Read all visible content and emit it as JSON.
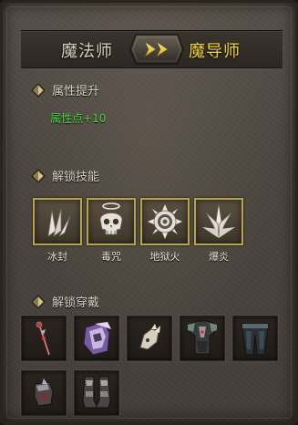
{
  "header": {
    "from_class": "魔法师",
    "to_class": "魔导师"
  },
  "attributes": {
    "title": "属性提升",
    "value": "属性点+10"
  },
  "skills": {
    "title": "解锁技能",
    "items": [
      {
        "name": "冰封",
        "icon": "ice-shard-icon"
      },
      {
        "name": "毒咒",
        "icon": "poison-skull-icon"
      },
      {
        "name": "地狱火",
        "icon": "hellfire-ring-icon"
      },
      {
        "name": "爆炎",
        "icon": "explosion-spike-icon"
      }
    ]
  },
  "gear": {
    "title": "解锁穿戴",
    "items": [
      {
        "icon": "staff-icon"
      },
      {
        "icon": "purple-helmet-icon"
      },
      {
        "icon": "bone-gauntlet-icon"
      },
      {
        "icon": "dark-armor-icon"
      },
      {
        "icon": "dark-leggings-icon"
      },
      {
        "icon": "bracer-icon"
      },
      {
        "icon": "boots-icon"
      }
    ]
  },
  "colors": {
    "gold": "#f2d33c",
    "green": "#46d63c",
    "frame_gold": "#b8a24a"
  }
}
